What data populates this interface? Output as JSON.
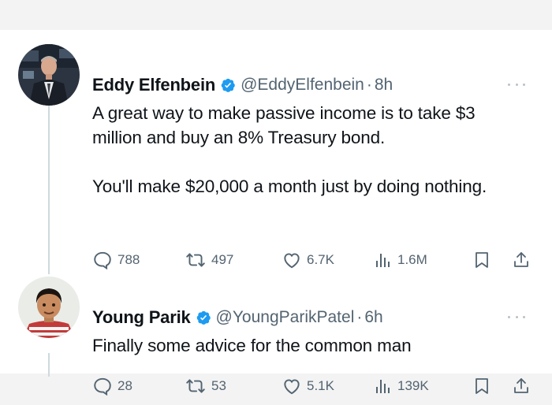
{
  "tweets": [
    {
      "author_name": "Eddy Elfenbein",
      "handle": "@EddyElfenbein",
      "separator": "·",
      "time": "8h",
      "paragraphs": [
        "A great way to make passive income is to take $3 million and buy an 8% Treasury bond.",
        "You'll make $20,000 a month just by doing nothing."
      ],
      "replies": "788",
      "reposts": "497",
      "likes": "6.7K",
      "views": "1.6M"
    },
    {
      "author_name": "Young Parik",
      "handle": "@YoungParikPatel",
      "separator": "·",
      "time": "6h",
      "paragraphs": [
        "Finally some advice for the common man"
      ],
      "replies": "28",
      "reposts": "53",
      "likes": "5.1K",
      "views": "139K"
    }
  ],
  "icons": {
    "verified": "verified-badge-icon",
    "more": "more-icon",
    "reply": "reply-icon",
    "repost": "repost-icon",
    "like": "like-icon",
    "views": "views-icon",
    "bookmark": "bookmark-icon",
    "share": "share-icon"
  },
  "colors": {
    "verified": "#1d9bf0",
    "text": "#0f1419",
    "secondary": "#536471",
    "thread_line": "#cfd9de"
  }
}
